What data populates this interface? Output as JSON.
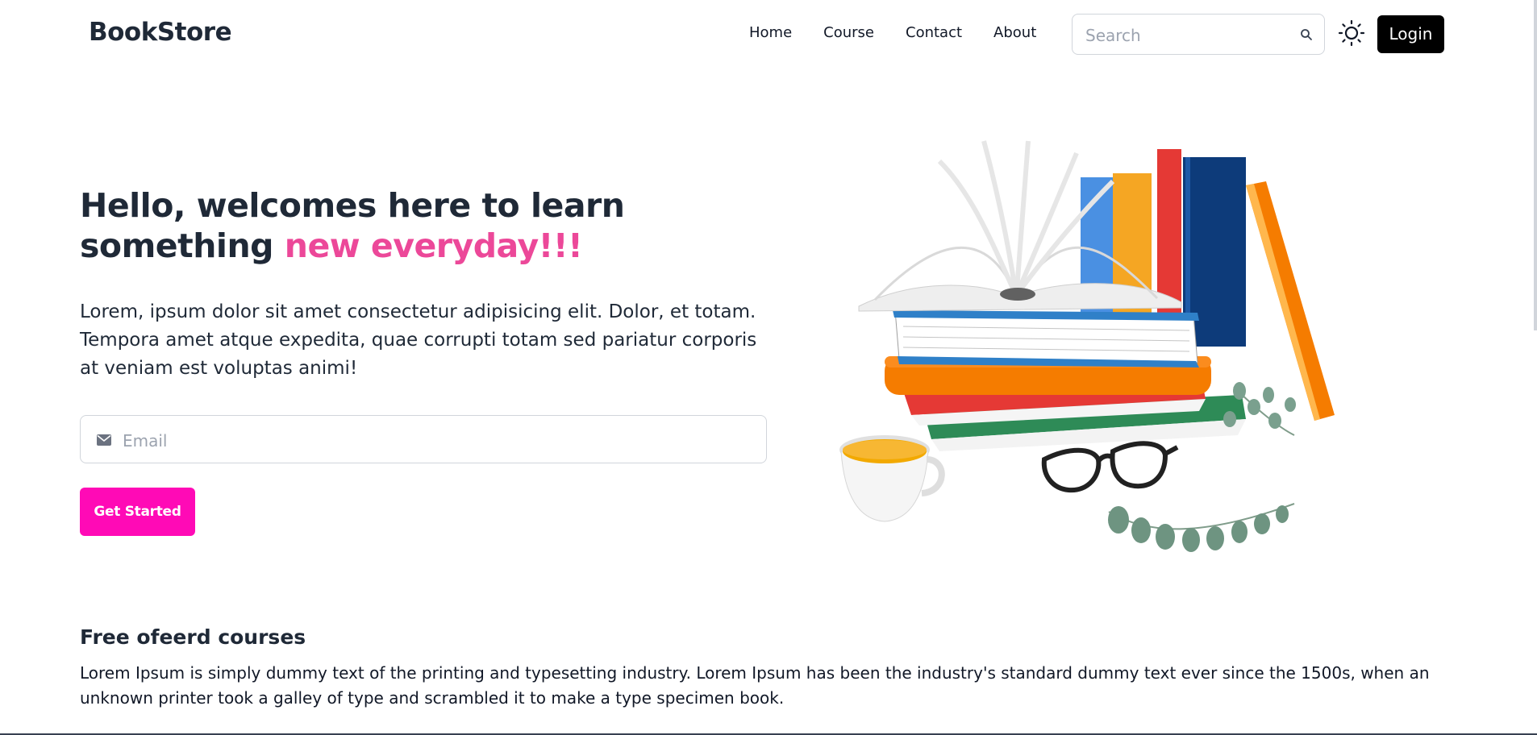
{
  "navbar": {
    "brand": "BookStore",
    "links": [
      "Home",
      "Course",
      "Contact",
      "About"
    ],
    "search_placeholder": "Search",
    "search_icon": "search-icon",
    "theme_icon": "sun-icon",
    "login_label": "Login"
  },
  "hero": {
    "title_main": "Hello, welcomes here to learn something ",
    "title_accent": "new everyday!!!",
    "description": "Lorem, ipsum dolor sit amet consectetur adipisicing elit. Dolor, et totam. Tempora amet atque expedita, quae corrupti totam sed pariatur corporis at veniam est voluptas animi!",
    "email_placeholder": "Email",
    "email_icon": "mail-icon",
    "cta_label": "Get Started",
    "illustration": "stack-of-books-illustration"
  },
  "courses_section": {
    "title": "Free ofeerd courses",
    "description": "Lorem Ipsum is simply dummy text of the printing and typesetting industry. Lorem Ipsum has been the industry's standard dummy text ever since the 1500s, when an unknown printer took a galley of type and scrambled it to make a type specimen book."
  },
  "colors": {
    "accent_pink": "#ec4899",
    "cta_magenta": "#ff0ab6",
    "login_black": "#000000",
    "text_dark": "#1f2937"
  }
}
